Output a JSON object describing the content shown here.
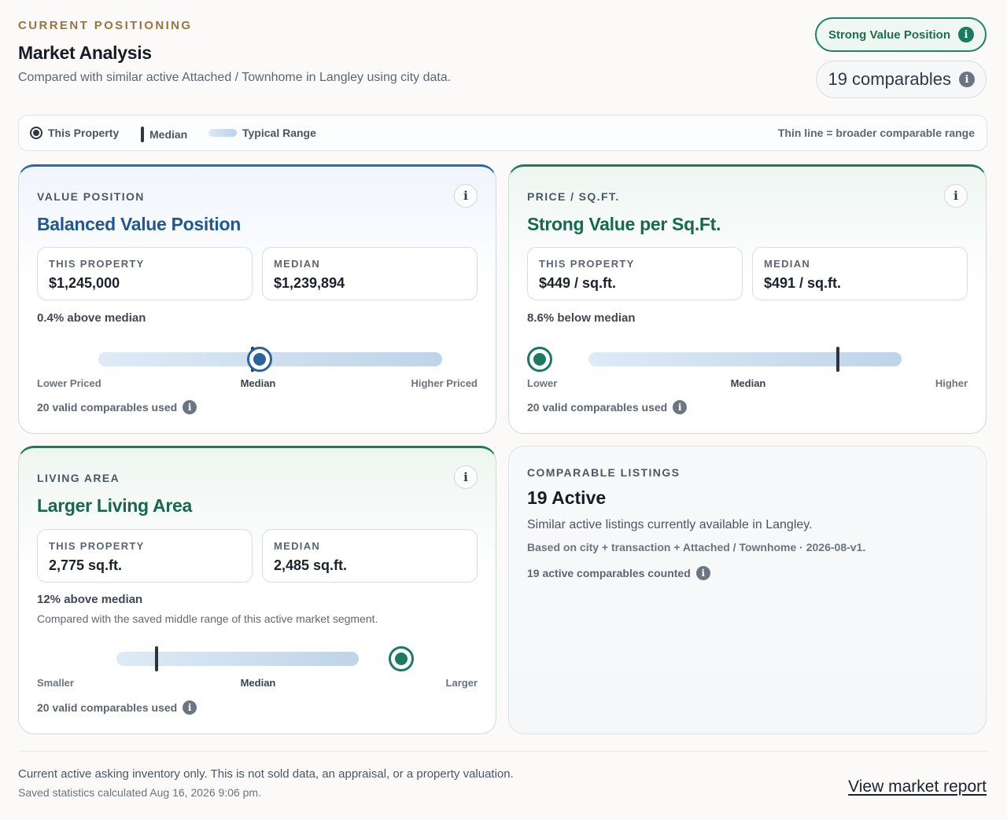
{
  "header": {
    "eyebrow": "CURRENT POSITIONING",
    "title": "Market Analysis",
    "subtitle": "Compared with similar active Attached / Townhome in Langley using city data.",
    "badge_label": "Strong Value Position",
    "comparables_label": "19 comparables"
  },
  "legend": {
    "this_property": "This Property",
    "median": "Median",
    "typical_range": "Typical Range",
    "note": "Thin line = broader comparable range"
  },
  "value_card": {
    "label": "VALUE POSITION",
    "headline": "Balanced Value Position",
    "this_label": "THIS PROPERTY",
    "this_value": "$1,245,000",
    "median_label": "MEDIAN",
    "median_value": "$1,239,894",
    "delta": "0.4% above median",
    "scale_low": "Lower Priced",
    "scale_mid": "Median",
    "scale_high": "Higher Priced",
    "used": "20 valid comparables used",
    "range_start": 0.14,
    "range_end": 0.92,
    "median_pos": 0.49,
    "property_pos": 0.505
  },
  "ppsf_card": {
    "label": "PRICE / SQ.FT.",
    "headline": "Strong Value per Sq.Ft.",
    "this_label": "THIS PROPERTY",
    "this_value": "$449 / sq.ft.",
    "median_label": "MEDIAN",
    "median_value": "$491 / sq.ft.",
    "delta": "8.6% below median",
    "scale_low": "Lower",
    "scale_mid": "Median",
    "scale_high": "Higher",
    "used": "20 valid comparables used",
    "range_start": 0.14,
    "range_end": 0.85,
    "median_pos": 0.706,
    "property_pos": 0.0
  },
  "area_card": {
    "label": "LIVING AREA",
    "headline": "Larger Living Area",
    "this_label": "THIS PROPERTY",
    "this_value": "2,775 sq.ft.",
    "median_label": "MEDIAN",
    "median_value": "2,485 sq.ft.",
    "delta": "12% above median",
    "note": "Compared with the saved middle range of this active market segment.",
    "scale_low": "Smaller",
    "scale_mid": "Median",
    "scale_high": "Larger",
    "used": "20 valid comparables used",
    "range_start": 0.18,
    "range_end": 0.73,
    "median_pos": 0.272,
    "property_pos": 0.826
  },
  "listings_card": {
    "label": "COMPARABLE LISTINGS",
    "count": "19 Active",
    "description": "Similar active listings currently available in Langley.",
    "meta": "Based on city + transaction + Attached / Townhome · 2026-08-v1.",
    "counted": "19 active comparables counted"
  },
  "footer": {
    "disclaimer": "Current active asking inventory only. This is not sold data, an appraisal, or a property valuation.",
    "calculated": "Saved statistics calculated Aug 16, 2026 9:06 pm.",
    "link": "View market report"
  },
  "colors": {
    "accent_gold": "#9a7440",
    "value_blue": "#2e68a6",
    "value_green": "#1c7a5e"
  }
}
